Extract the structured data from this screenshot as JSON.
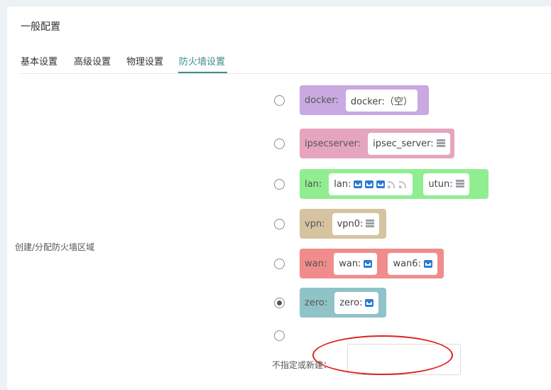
{
  "panel": {
    "title": "一般配置"
  },
  "tabs": [
    {
      "label": "基本设置"
    },
    {
      "label": "高级设置"
    },
    {
      "label": "物理设置"
    },
    {
      "label": "防火墙设置"
    }
  ],
  "field": {
    "label": "创建/分配防火墙区域"
  },
  "zones": [
    {
      "name": "docker:",
      "color": "#c9a9e1",
      "checked": false,
      "devices": [
        {
          "label": "docker:（空）",
          "icons": []
        }
      ]
    },
    {
      "name": "ipsecserver:",
      "color": "#e6a5bf",
      "checked": false,
      "devices": [
        {
          "label": "ipsec_server:",
          "icons": [
            "server-icon"
          ]
        }
      ]
    },
    {
      "name": "lan:",
      "color": "#90ee90",
      "checked": false,
      "devices": [
        {
          "label": "lan:",
          "icons": [
            "ethernet-icon",
            "ethernet-icon",
            "ethernet-icon",
            "wifi-icon",
            "wifi-icon"
          ]
        },
        {
          "label": "utun:",
          "icons": [
            "server-icon"
          ]
        }
      ]
    },
    {
      "name": "vpn:",
      "color": "#d6c3a0",
      "checked": false,
      "devices": [
        {
          "label": "vpn0:",
          "icons": [
            "server-icon"
          ]
        }
      ]
    },
    {
      "name": "wan:",
      "color": "#f08c8c",
      "checked": false,
      "devices": [
        {
          "label": "wan:",
          "icons": [
            "ethernet-icon"
          ]
        },
        {
          "label": "wan6:",
          "icons": [
            "ethernet-icon"
          ]
        }
      ]
    },
    {
      "name": "zero:",
      "color": "#90c3c8",
      "checked": true,
      "devices": [
        {
          "label": "zero:",
          "icons": [
            "ethernet-icon"
          ]
        }
      ]
    }
  ],
  "new_zone": {
    "label": "不指定或新建：",
    "value": ""
  },
  "colors": {
    "accent": "#3f8f88",
    "annotation": "#e02020"
  }
}
